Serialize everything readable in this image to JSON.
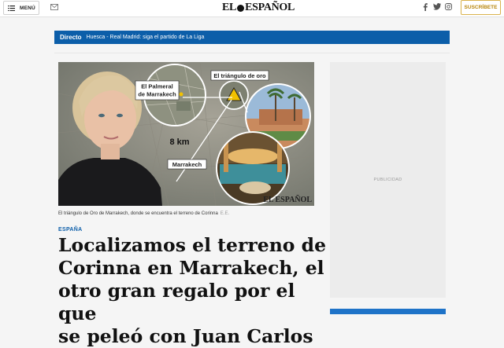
{
  "header": {
    "menu_label": "MENÚ",
    "logo_left": "EL",
    "logo_right": "ESPAÑOL",
    "subscribe_label": "SUSCRÍBETE"
  },
  "icons": [
    "hamburger-icon",
    "mail-icon",
    "facebook-icon",
    "twitter-icon",
    "instagram-icon"
  ],
  "live": {
    "tag": "Directo",
    "text": "Huesca - Real Madrid: siga el partido de La Liga"
  },
  "hero": {
    "map_labels": {
      "palmeral_line1": "El Palmeral",
      "palmeral_line2": "de Marrakech",
      "triangle": "El triángulo de oro",
      "distance": "8 km",
      "city": "Marrakech"
    },
    "watermark": "EL ESPAÑOL"
  },
  "caption": {
    "text": "El triángulo de Oro de Marrakech, donde se encuentra el terreno de Corinna",
    "credit": "E.E."
  },
  "article": {
    "section": "ESPAÑA",
    "headline_lines": [
      "Localizamos el terreno de",
      "Corinna en Marrakech, el",
      "otro gran regalo por el que",
      "se peleó con Juan Carlos"
    ]
  },
  "ad": {
    "label": "PUBLICIDAD"
  },
  "colors": {
    "brand_blue": "#0c5ea9",
    "subscribe_gold": "#b8860b"
  }
}
